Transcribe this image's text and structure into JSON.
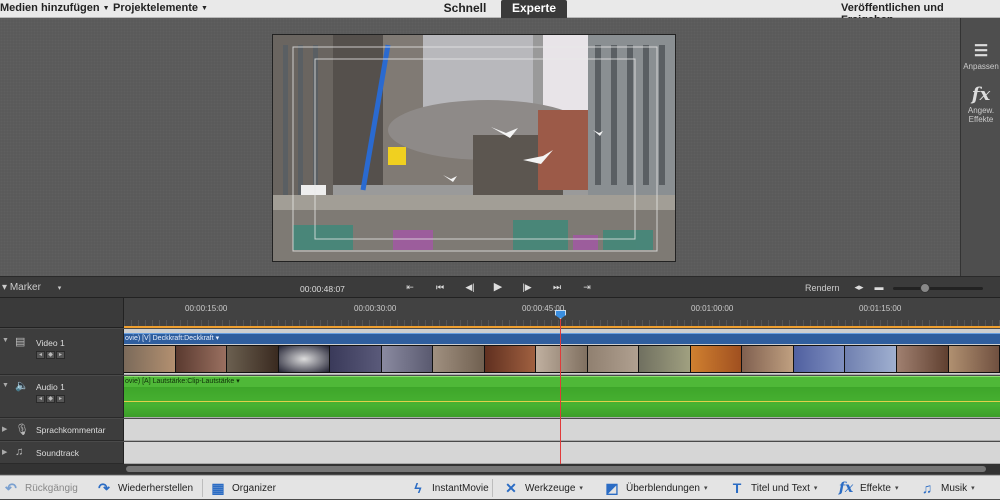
{
  "top": {
    "add_media": "Medien hinzufügen",
    "project_assets": "Projektelemente",
    "mode_quick": "Schnell",
    "mode_expert": "Experte",
    "publish": "Veröffentlichen und Freigeben"
  },
  "right_panel": {
    "adjust_label": "Anpassen",
    "applied_effects_label": "Angew. Effekte"
  },
  "transport": {
    "marker_label": "Marker",
    "timecode": "00:00:48:07",
    "render_label": "Rendern"
  },
  "ruler": {
    "ticks": [
      "00:00:15:00",
      "00:00:30:00",
      "00:00:45:00",
      "00:01:00:00",
      "00:01:15:00"
    ]
  },
  "tracks": {
    "video1": "Video 1",
    "audio1": "Audio 1",
    "narration": "Sprachkommentar",
    "soundtrack": "Soundtrack"
  },
  "clips": {
    "video_label": "ovie) [V] Deckkraft:Deckkraft ▾",
    "audio_label": "ovie) [A]  Lautstärke:Clip-Lautstärke ▾"
  },
  "bottom": {
    "undo": "Rückgängig",
    "redo": "Wiederherstellen",
    "organizer": "Organizer",
    "instant_movie": "InstantMovie",
    "tools": "Werkzeuge",
    "transitions": "Überblendungen",
    "titles": "Titel und Text",
    "effects": "Effekte",
    "music": "Musik"
  },
  "colors": {
    "accent_blue": "#2b6cc4",
    "video_clip": "#2f5e9e",
    "audio_clip": "#48b232",
    "playhead": "#e03a3a"
  }
}
